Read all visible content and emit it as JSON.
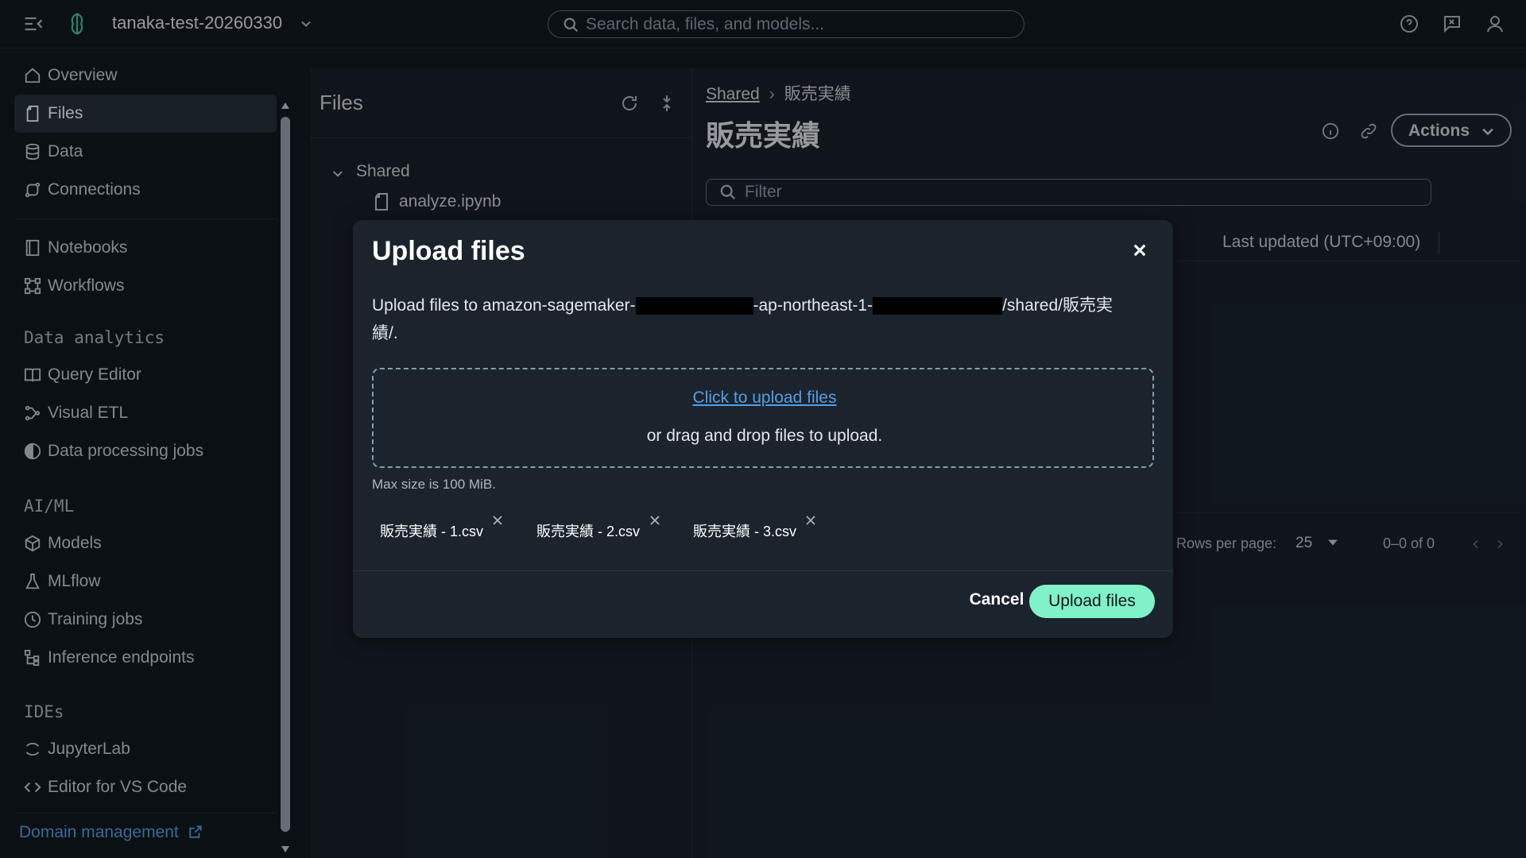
{
  "topbar": {
    "project_name": "tanaka-test-20260330",
    "search_placeholder": "Search data, files, and models..."
  },
  "sidebar": {
    "items_top": [
      {
        "label": "Overview",
        "icon": "home-icon"
      },
      {
        "label": "Files",
        "icon": "file-icon",
        "active": true
      },
      {
        "label": "Data",
        "icon": "database-icon"
      },
      {
        "label": "Connections",
        "icon": "connections-icon"
      }
    ],
    "items_build": [
      {
        "label": "Notebooks",
        "icon": "notebook-icon"
      },
      {
        "label": "Workflows",
        "icon": "workflow-icon"
      }
    ],
    "section_data_analytics": "Data analytics",
    "items_analytics": [
      {
        "label": "Query Editor",
        "icon": "book-icon"
      },
      {
        "label": "Visual ETL",
        "icon": "etl-icon"
      },
      {
        "label": "Data processing jobs",
        "icon": "processing-icon"
      }
    ],
    "section_aiml": "AI/ML",
    "items_aiml": [
      {
        "label": "Models",
        "icon": "cube-icon"
      },
      {
        "label": "MLflow",
        "icon": "flask-icon"
      },
      {
        "label": "Training jobs",
        "icon": "clock-icon"
      },
      {
        "label": "Inference endpoints",
        "icon": "endpoint-icon"
      }
    ],
    "section_ides": "IDEs",
    "items_ides": [
      {
        "label": "JupyterLab",
        "icon": "jupyter-icon"
      },
      {
        "label": "Editor for VS Code",
        "icon": "code-icon"
      }
    ],
    "domain_management": "Domain management"
  },
  "files_panel": {
    "title": "Files",
    "tree_folder": "Shared",
    "tree_file": "analyze.ipynb"
  },
  "main": {
    "breadcrumb_root": "Shared",
    "breadcrumb_current": "販売実績",
    "title": "販売実績",
    "actions_label": "Actions",
    "filter_placeholder": "Filter",
    "col_last_updated": "Last updated (UTC+09:00)",
    "rows_per_page_label": "Rows per page:",
    "rows_per_page_value": "25",
    "pagination_text": "0–0 of 0"
  },
  "modal": {
    "title": "Upload files",
    "desc_prefix": "Upload files to amazon-sagemaker-",
    "desc_middle": "-ap-northeast-1-",
    "desc_suffix": "/shared/販売実",
    "desc_line2": "績/.",
    "drop_link": "Click to upload files",
    "drop_text": "or drag and drop files to upload.",
    "max_size": "Max size is 100 MiB.",
    "files": [
      "販売実績 - 1.csv",
      "販売実績 - 2.csv",
      "販売実績 - 3.csv"
    ],
    "cancel_label": "Cancel",
    "upload_label": "Upload files"
  },
  "colors": {
    "accent": "#7ff2c7",
    "link": "#539fe5",
    "background": "#0f141a",
    "modal_bg": "#1b232d"
  }
}
